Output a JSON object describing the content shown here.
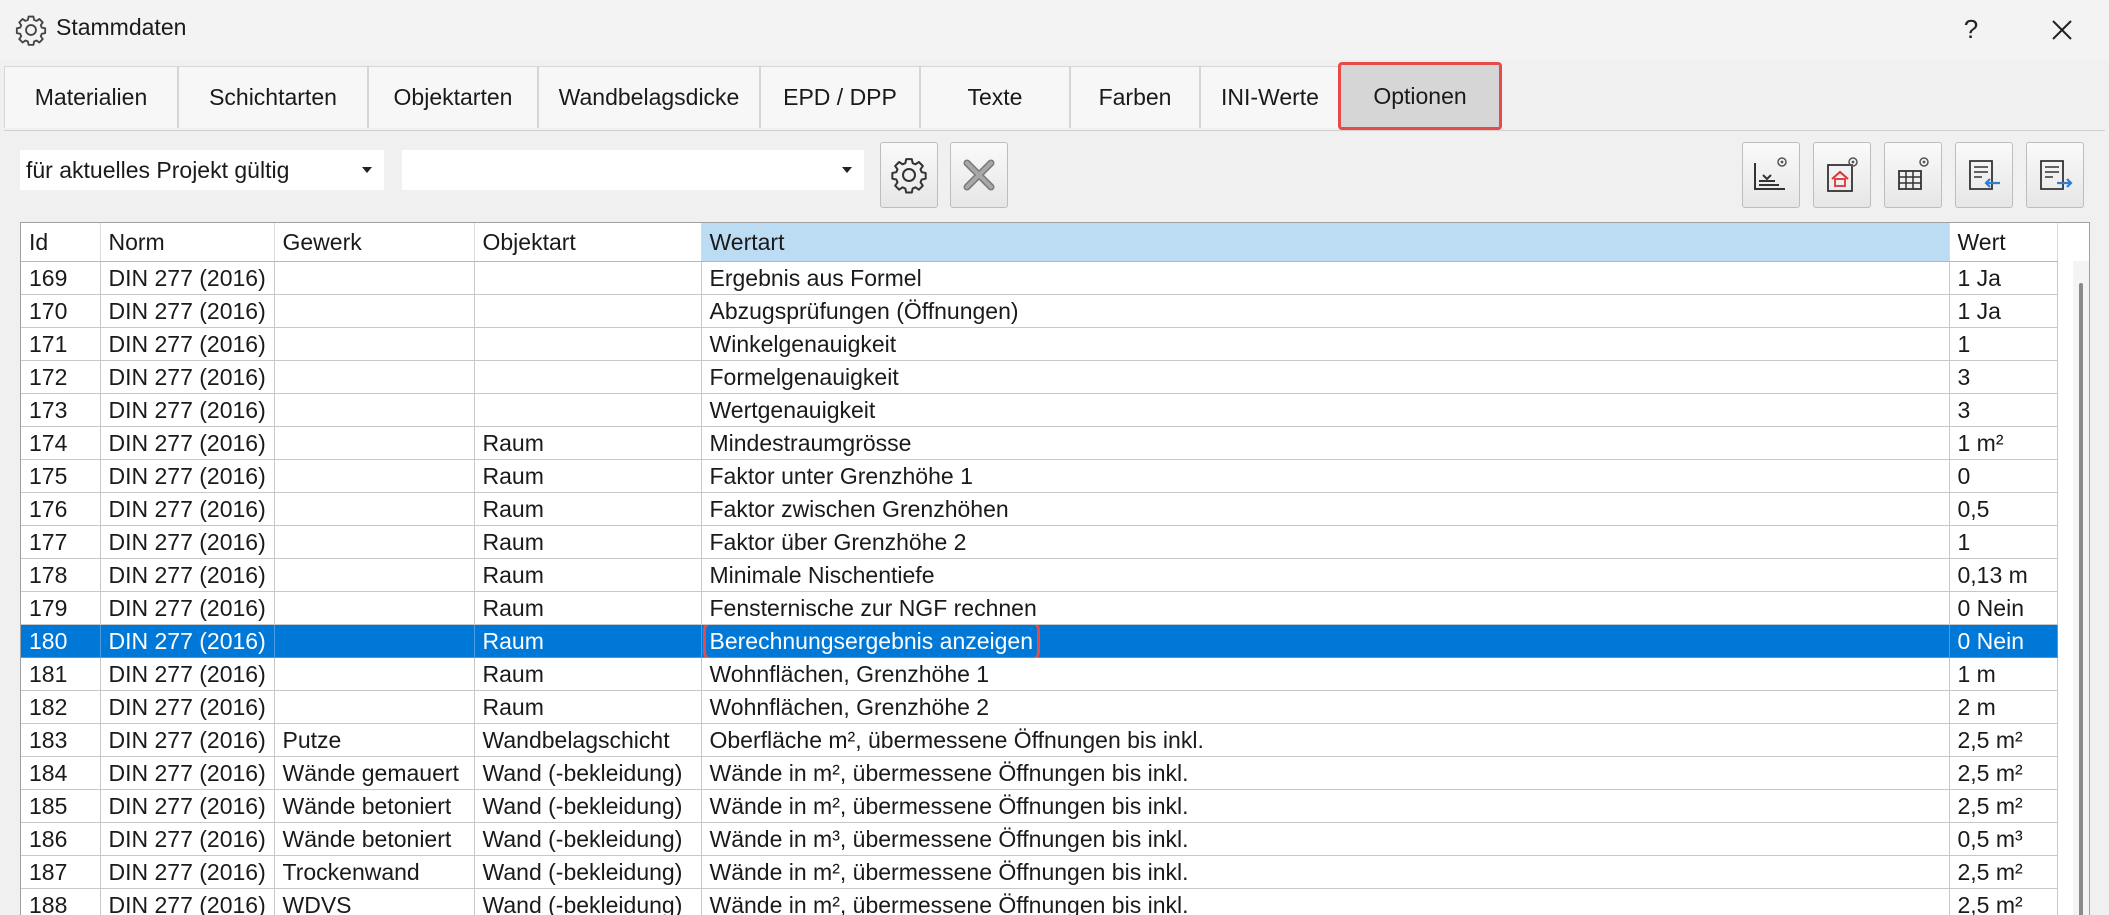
{
  "window": {
    "title": "Stammdaten",
    "help_label": "?"
  },
  "tabs": [
    {
      "label": "Materialien"
    },
    {
      "label": "Schichtarten"
    },
    {
      "label": "Objektarten"
    },
    {
      "label": "Wandbelagsdicke"
    },
    {
      "label": "EPD / DPP"
    },
    {
      "label": "Texte"
    },
    {
      "label": "Farben"
    },
    {
      "label": "INI-Werte"
    },
    {
      "label": "Optionen",
      "active": true
    }
  ],
  "toolbar": {
    "scope_select": "für aktuelles Projekt gültig",
    "filter_select": "",
    "settings_icon": "gear-icon",
    "delete_icon": "x-icon",
    "right_icons": [
      "floor-settings-icon",
      "house-settings-icon",
      "table-settings-icon",
      "import-list-icon",
      "export-list-icon"
    ]
  },
  "table": {
    "columns": [
      "Id",
      "Norm",
      "Gewerk",
      "Objektart",
      "Wertart",
      "Wert"
    ],
    "sorted_column": "Wertart",
    "selected_id": "180",
    "rows": [
      {
        "id": "169",
        "norm": "DIN 277 (2016)",
        "gewerk": "",
        "objektart": "",
        "wertart": "Ergebnis aus Formel",
        "wert": "1 Ja"
      },
      {
        "id": "170",
        "norm": "DIN 277 (2016)",
        "gewerk": "",
        "objektart": "",
        "wertart": "Abzugsprüfungen (Öffnungen)",
        "wert": "1 Ja"
      },
      {
        "id": "171",
        "norm": "DIN 277 (2016)",
        "gewerk": "",
        "objektart": "",
        "wertart": "Winkelgenauigkeit",
        "wert": "1"
      },
      {
        "id": "172",
        "norm": "DIN 277 (2016)",
        "gewerk": "",
        "objektart": "",
        "wertart": "Formelgenauigkeit",
        "wert": "3"
      },
      {
        "id": "173",
        "norm": "DIN 277 (2016)",
        "gewerk": "",
        "objektart": "",
        "wertart": "Wertgenauigkeit",
        "wert": "3"
      },
      {
        "id": "174",
        "norm": "DIN 277 (2016)",
        "gewerk": "",
        "objektart": "Raum",
        "wertart": "Mindestraumgrösse",
        "wert": "1 m²"
      },
      {
        "id": "175",
        "norm": "DIN 277 (2016)",
        "gewerk": "",
        "objektart": "Raum",
        "wertart": "Faktor unter Grenzhöhe 1",
        "wert": "0"
      },
      {
        "id": "176",
        "norm": "DIN 277 (2016)",
        "gewerk": "",
        "objektart": "Raum",
        "wertart": "Faktor zwischen Grenzhöhen",
        "wert": "0,5"
      },
      {
        "id": "177",
        "norm": "DIN 277 (2016)",
        "gewerk": "",
        "objektart": "Raum",
        "wertart": "Faktor über Grenzhöhe 2",
        "wert": "1"
      },
      {
        "id": "178",
        "norm": "DIN 277 (2016)",
        "gewerk": "",
        "objektart": "Raum",
        "wertart": "Minimale Nischentiefe",
        "wert": "0,13 m"
      },
      {
        "id": "179",
        "norm": "DIN 277 (2016)",
        "gewerk": "",
        "objektart": "Raum",
        "wertart": "Fensternische zur NGF rechnen",
        "wert": "0 Nein"
      },
      {
        "id": "180",
        "norm": "DIN 277 (2016)",
        "gewerk": "",
        "objektart": "Raum",
        "wertart": "Berechnungsergebnis anzeigen",
        "wert": "0 Nein"
      },
      {
        "id": "181",
        "norm": "DIN 277 (2016)",
        "gewerk": "",
        "objektart": "Raum",
        "wertart": "Wohnflächen, Grenzhöhe 1",
        "wert": "1 m"
      },
      {
        "id": "182",
        "norm": "DIN 277 (2016)",
        "gewerk": "",
        "objektart": "Raum",
        "wertart": "Wohnflächen, Grenzhöhe 2",
        "wert": "2 m"
      },
      {
        "id": "183",
        "norm": "DIN 277 (2016)",
        "gewerk": "Putze",
        "objektart": "Wandbelagschicht",
        "wertart": "Oberfläche m², übermessene Öffnungen bis inkl.",
        "wert": "2,5 m²"
      },
      {
        "id": "184",
        "norm": "DIN 277 (2016)",
        "gewerk": "Wände gemauert",
        "objektart": "Wand (-bekleidung)",
        "wertart": "Wände in m², übermessene Öffnungen bis inkl.",
        "wert": "2,5 m²"
      },
      {
        "id": "185",
        "norm": "DIN 277 (2016)",
        "gewerk": "Wände betoniert",
        "objektart": "Wand (-bekleidung)",
        "wertart": "Wände in m², übermessene Öffnungen bis inkl.",
        "wert": "2,5 m²"
      },
      {
        "id": "186",
        "norm": "DIN 277 (2016)",
        "gewerk": "Wände betoniert",
        "objektart": "Wand (-bekleidung)",
        "wertart": "Wände in m³, übermessene Öffnungen bis inkl.",
        "wert": "0,5 m³"
      },
      {
        "id": "187",
        "norm": "DIN 277 (2016)",
        "gewerk": "Trockenwand",
        "objektart": "Wand (-bekleidung)",
        "wertart": "Wände in m², übermessene Öffnungen bis inkl.",
        "wert": "2,5 m²"
      },
      {
        "id": "188",
        "norm": "DIN 277 (2016)",
        "gewerk": "WDVS",
        "objektart": "Wand (-bekleidung)",
        "wertart": "Wände in m², übermessene Öffnungen bis inkl.",
        "wert": "2,5 m²"
      }
    ]
  },
  "colors": {
    "selection": "#0078d7",
    "sorted_header": "#bcdcf4",
    "highlight_outline": "#e84a4a"
  }
}
